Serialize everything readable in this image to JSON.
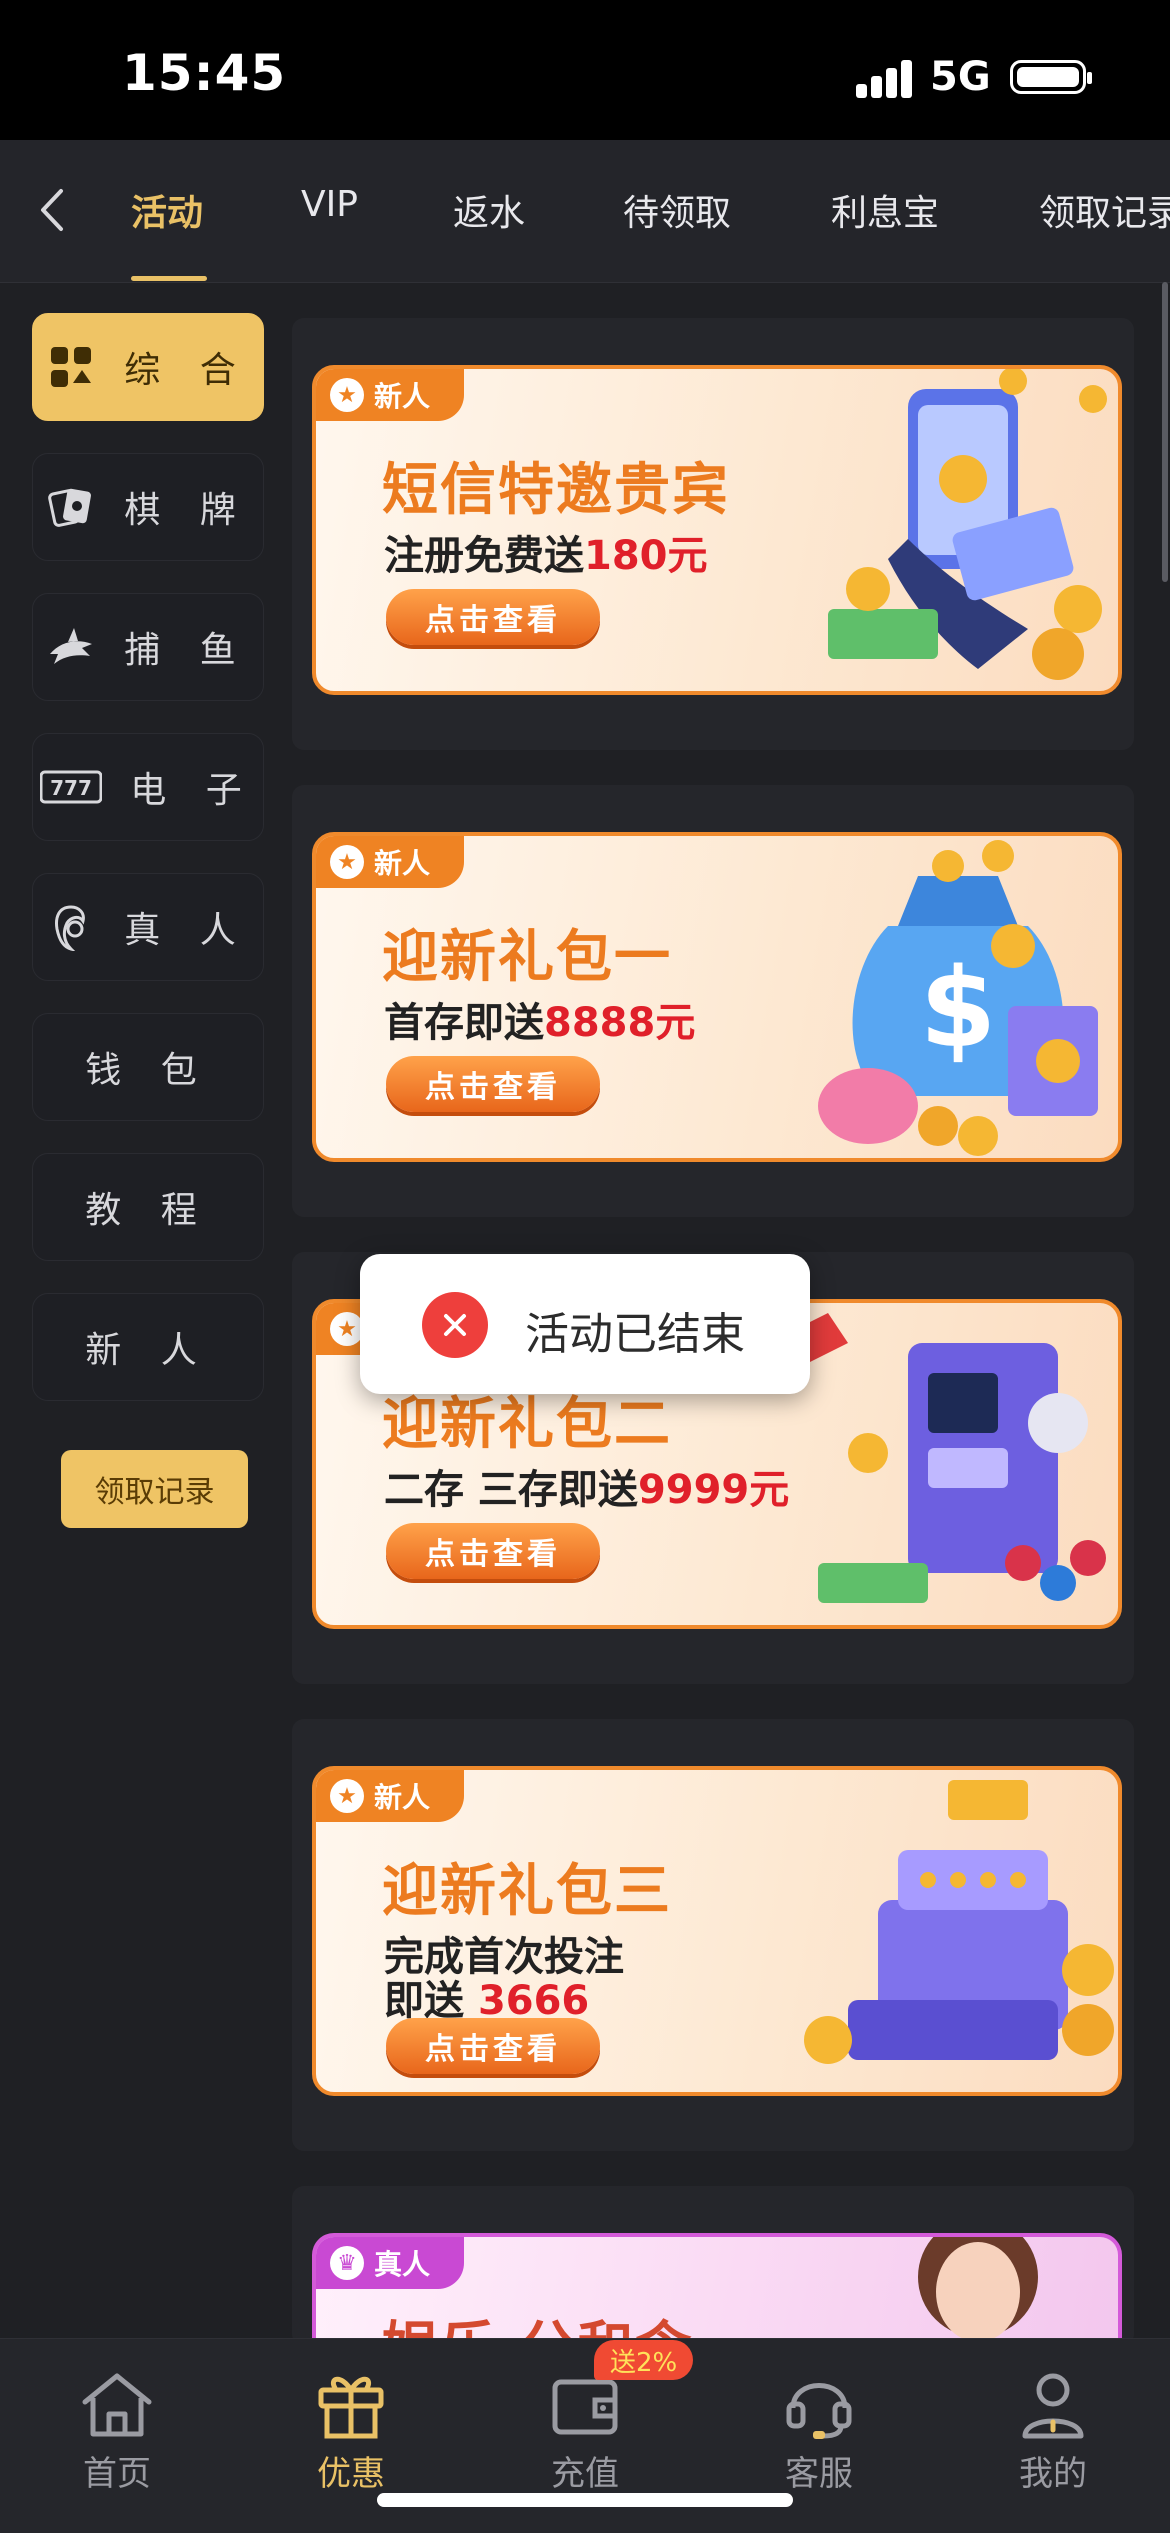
{
  "status": {
    "time": "15:45",
    "network": "5G"
  },
  "tabs": [
    "活动",
    "VIP",
    "返水",
    "待领取",
    "利息宝",
    "领取记录"
  ],
  "sidebar": {
    "items": [
      {
        "label": "综 合",
        "icon": "grid-icon"
      },
      {
        "label": "棋 牌",
        "icon": "cards-icon"
      },
      {
        "label": "捕 鱼",
        "icon": "shark-icon"
      },
      {
        "label": "电 子",
        "icon": "slot-777-icon"
      },
      {
        "label": "真 人",
        "icon": "dealer-icon"
      },
      {
        "label": "钱 包",
        "icon": ""
      },
      {
        "label": "教 程",
        "icon": ""
      },
      {
        "label": "新 人",
        "icon": ""
      }
    ],
    "records_button": "领取记录"
  },
  "banners": [
    {
      "badge": "新人",
      "title": "短信特邀贵宾",
      "sub_prefix": "注册免费送",
      "sub_highlight": "180元",
      "button": "点击查看"
    },
    {
      "badge": "新人",
      "title": "迎新礼包一",
      "sub_prefix": "首存即送",
      "sub_highlight": "8888元",
      "button": "点击查看"
    },
    {
      "badge": "新人",
      "title": "迎新礼包二",
      "sub_prefix": "二存 三存即送",
      "sub_highlight": "9999元",
      "button": "点击查看"
    },
    {
      "badge": "新人",
      "title": "迎新礼包三",
      "sub_prefix": "完成首次投注",
      "sub_line2_prefix": "即送",
      "sub_highlight": "3666",
      "button": "点击查看"
    },
    {
      "badge": "真人",
      "title": "娱乐 分和含",
      "partial": true
    }
  ],
  "toast": {
    "text": "活动已结束"
  },
  "bottom_nav": [
    {
      "label": "首页",
      "icon": "home-icon"
    },
    {
      "label": "优惠",
      "icon": "gift-icon"
    },
    {
      "label": "充值",
      "icon": "wallet-icon",
      "badge": "送2%"
    },
    {
      "label": "客服",
      "icon": "headset-icon"
    },
    {
      "label": "我的",
      "icon": "user-icon"
    }
  ],
  "colors": {
    "accent": "#e9c166",
    "banner_orange": "#ef8323",
    "highlight_red": "#e0202a",
    "toast_error": "#ee3f3c"
  }
}
